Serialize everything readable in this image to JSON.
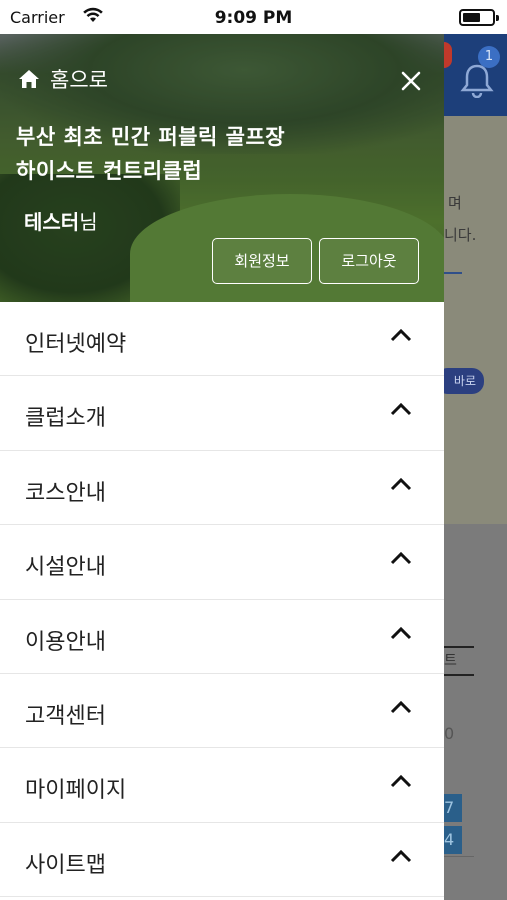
{
  "status_bar": {
    "carrier": "Carrier",
    "time": "9:09 PM"
  },
  "drawer": {
    "home_label": "홈으로",
    "title_line1": "부산 최초 민간 퍼블릭 골프장",
    "title_line2": "하이스트 컨트리클럽",
    "user_name": "테스터",
    "user_suffix": "님",
    "member_info_button": "회원정보",
    "logout_button": "로그아웃",
    "menu_items": [
      {
        "label": "인터넷예약"
      },
      {
        "label": "클럽소개"
      },
      {
        "label": "코스안내"
      },
      {
        "label": "시설안내"
      },
      {
        "label": "이용안내"
      },
      {
        "label": "고객센터"
      },
      {
        "label": "마이페이지"
      },
      {
        "label": "사이트맵"
      }
    ]
  },
  "background_page": {
    "notification_count": "1",
    "text_fragment_1": "며",
    "text_fragment_2": "니다.",
    "pill_text": "바로",
    "tab_fragment": "트",
    "small_fragment": "0",
    "cell_1": "7",
    "cell_2": "4"
  },
  "colors": {
    "header_blue": "#1d3f7a",
    "accent_red": "#c0392b",
    "divider": "#e6e6e6"
  },
  "icons": [
    "wifi-icon",
    "battery-icon",
    "home-icon",
    "close-icon",
    "chevron-up-icon",
    "bell-icon"
  ]
}
